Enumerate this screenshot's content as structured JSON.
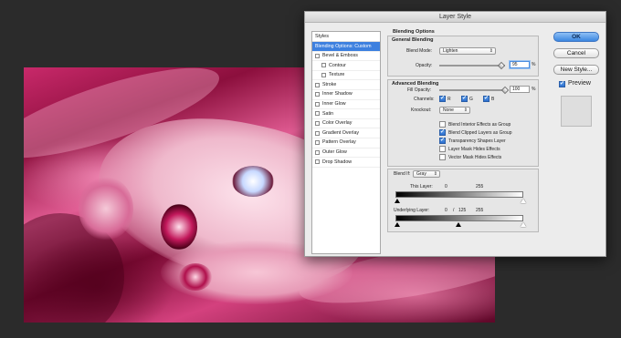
{
  "dialog": {
    "title": "Layer Style",
    "buttons": {
      "ok": "OK",
      "cancel": "Cancel",
      "new_style": "New Style...",
      "preview": "Preview"
    }
  },
  "styles_list": {
    "header": "Styles",
    "items": [
      {
        "label": "Blending Options: Custom",
        "selected": true,
        "checkbox": false,
        "sub": false
      },
      {
        "label": "Bevel & Emboss",
        "selected": false,
        "checkbox": true,
        "sub": false
      },
      {
        "label": "Contour",
        "selected": false,
        "checkbox": true,
        "sub": true
      },
      {
        "label": "Texture",
        "selected": false,
        "checkbox": true,
        "sub": true
      },
      {
        "label": "Stroke",
        "selected": false,
        "checkbox": true,
        "sub": false
      },
      {
        "label": "Inner Shadow",
        "selected": false,
        "checkbox": true,
        "sub": false
      },
      {
        "label": "Inner Glow",
        "selected": false,
        "checkbox": true,
        "sub": false
      },
      {
        "label": "Satin",
        "selected": false,
        "checkbox": true,
        "sub": false
      },
      {
        "label": "Color Overlay",
        "selected": false,
        "checkbox": true,
        "sub": false
      },
      {
        "label": "Gradient Overlay",
        "selected": false,
        "checkbox": true,
        "sub": false
      },
      {
        "label": "Pattern Overlay",
        "selected": false,
        "checkbox": true,
        "sub": false
      },
      {
        "label": "Outer Glow",
        "selected": false,
        "checkbox": true,
        "sub": false
      },
      {
        "label": "Drop Shadow",
        "selected": false,
        "checkbox": true,
        "sub": false
      }
    ]
  },
  "blending_options": {
    "section_title": "Blending Options",
    "general": {
      "title": "General Blending",
      "blend_mode_label": "Blend Mode:",
      "blend_mode_value": "Lighten",
      "opacity_label": "Opacity:",
      "opacity_value": "95",
      "opacity_unit": "%",
      "opacity_fraction": 0.95
    },
    "advanced": {
      "title": "Advanced Blending",
      "fill_opacity_label": "Fill Opacity:",
      "fill_opacity_value": "100",
      "fill_opacity_unit": "%",
      "channels_label": "Channels:",
      "channel_r": "R",
      "channel_g": "G",
      "channel_b": "B",
      "knockout_label": "Knockout:",
      "knockout_value": "None",
      "options": [
        {
          "label": "Blend Interior Effects as Group",
          "checked": false
        },
        {
          "label": "Blend Clipped Layers as Group",
          "checked": true
        },
        {
          "label": "Transparency Shapes Layer",
          "checked": true
        },
        {
          "label": "Layer Mask Hides Effects",
          "checked": false
        },
        {
          "label": "Vector Mask Hides Effects",
          "checked": false
        }
      ]
    },
    "blend_if": {
      "label": "Blend If:",
      "value": "Gray",
      "this_layer_label": "This Layer:",
      "this_layer_low": "0",
      "this_layer_high": "255",
      "underlying_label": "Underlying Layer:",
      "underlying_low": "0",
      "underlying_sep": "/",
      "underlying_mid": "125",
      "underlying_high": "255"
    }
  },
  "colors": {
    "accent": "#3d80df",
    "canvas_pink": "#c8296a",
    "background": "#2b2b2b"
  }
}
